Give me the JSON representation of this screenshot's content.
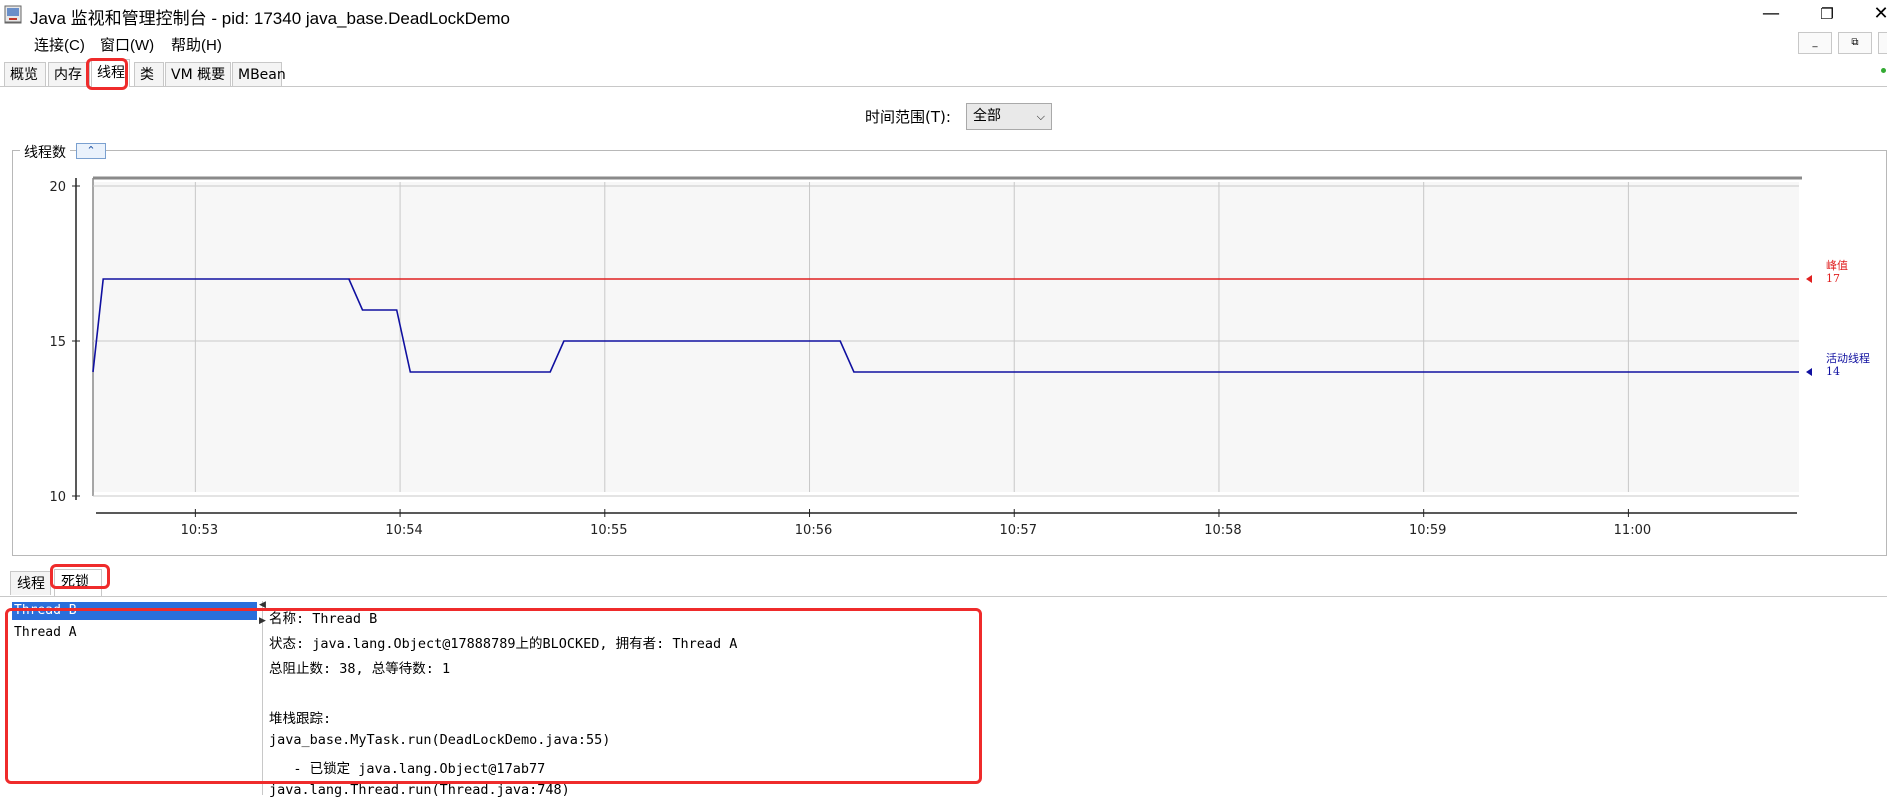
{
  "window": {
    "title": "Java 监视和管理控制台 - pid: 17340 java_base.DeadLockDemo",
    "app_icon": "java-console-icon",
    "controls": {
      "minimize": "—",
      "maximize": "❐",
      "close": "✕"
    }
  },
  "menu": {
    "items": [
      {
        "label": "连接(C)"
      },
      {
        "label": "窗口(W)"
      },
      {
        "label": "帮助(H)"
      }
    ],
    "mdi_controls": {
      "minimize": "_",
      "restore": "⧉"
    }
  },
  "tabs": [
    {
      "label": "概览",
      "active": false
    },
    {
      "label": "内存",
      "active": false
    },
    {
      "label": "线程",
      "active": true
    },
    {
      "label": "类",
      "active": false
    },
    {
      "label": "VM 概要",
      "active": false
    },
    {
      "label": "MBean",
      "active": false
    }
  ],
  "time_range": {
    "label": "时间范围(T):",
    "selected": "全部"
  },
  "chart_panel": {
    "title": "线程数",
    "collapse_icon": "double-chevron-up-icon"
  },
  "chart_data": {
    "type": "line",
    "x_ticks": [
      "10:53",
      "10:54",
      "10:55",
      "10:56",
      "10:57",
      "10:58",
      "10:59",
      "11:00"
    ],
    "ylim": [
      10,
      20
    ],
    "y_ticks": [
      "10",
      "15",
      "20"
    ],
    "grid": true,
    "series": [
      {
        "name": "峰值",
        "color": "#e02020",
        "current": "17",
        "points": [
          [
            "10:53:45",
            17
          ],
          [
            "11:00:50",
            17
          ]
        ]
      },
      {
        "name": "活动线程",
        "color": "#1010a0",
        "current": "14",
        "points": [
          [
            "10:52:30",
            14
          ],
          [
            "10:52:33",
            17
          ],
          [
            "10:53:45",
            17
          ],
          [
            "10:53:49",
            16
          ],
          [
            "10:53:59",
            16
          ],
          [
            "10:54:03",
            14
          ],
          [
            "10:54:44",
            14
          ],
          [
            "10:54:48",
            15
          ],
          [
            "10:56:09",
            15
          ],
          [
            "10:56:13",
            14
          ],
          [
            "11:00:50",
            14
          ]
        ]
      }
    ]
  },
  "lower_tabs": [
    {
      "label": "线程",
      "active": false
    },
    {
      "label": "死锁",
      "active": true
    }
  ],
  "thread_list": [
    {
      "label": "Thread B",
      "selected": true
    },
    {
      "label": "Thread A",
      "selected": false
    }
  ],
  "details": [
    "名称: Thread B",
    "状态: java.lang.Object@17888789上的BLOCKED, 拥有者: Thread A",
    "总阻止数: 38, 总等待数: 1",
    "",
    "堆栈跟踪:",
    "java_base.MyTask.run(DeadLockDemo.java:55)",
    "   - 已锁定 java.lang.Object@17ab77",
    "java.lang.Thread.run(Thread.java:748)"
  ]
}
